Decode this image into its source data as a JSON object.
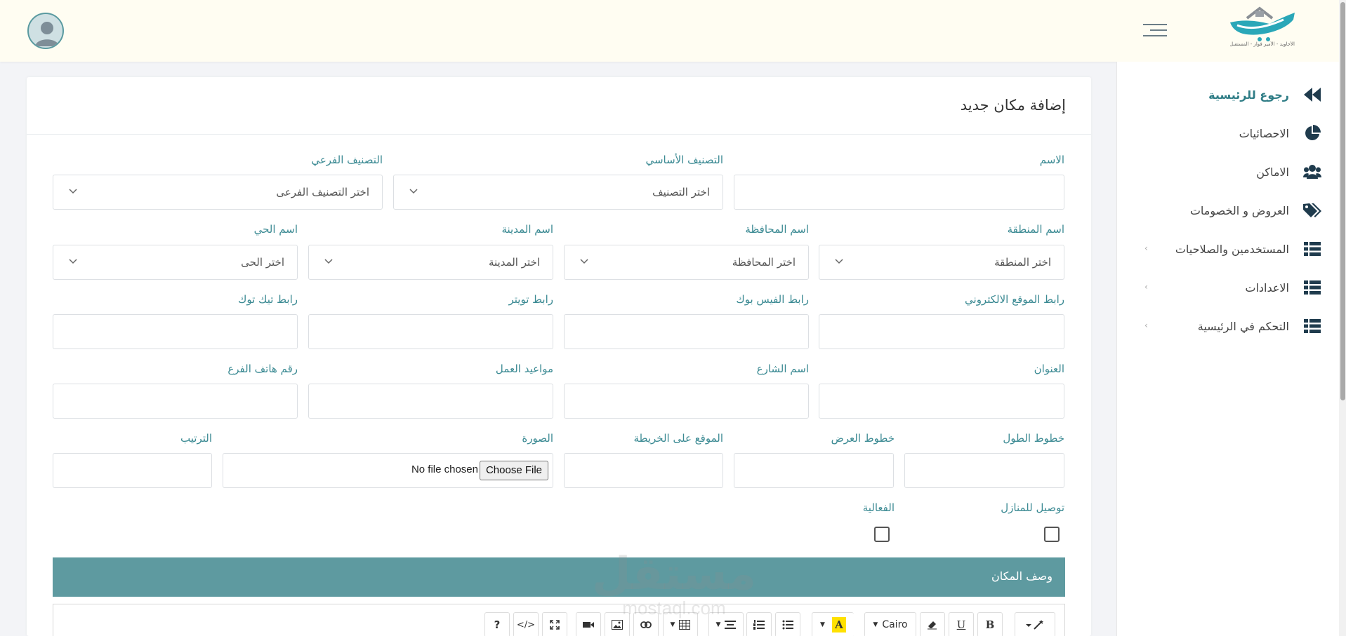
{
  "header": {
    "logo_tagline": "الأجاويد - الأمير فواز - المستقبل"
  },
  "sidebar": {
    "items": [
      {
        "label": "رجوع للرئيسية",
        "icon": "double-chevron-left-icon"
      },
      {
        "label": "الاحصائيات",
        "icon": "pie-chart-icon"
      },
      {
        "label": "الاماكن",
        "icon": "users-icon"
      },
      {
        "label": "العروض و الخصومات",
        "icon": "tags-icon"
      },
      {
        "label": "المستخدمين والصلاحيات",
        "icon": "list-icon"
      },
      {
        "label": "الاعدادات",
        "icon": "list-icon"
      },
      {
        "label": "التحكم في الرئيسية",
        "icon": "list-icon"
      }
    ]
  },
  "form": {
    "title": "إضافة مكان جديد",
    "labels": {
      "name": "الاسم",
      "main_category": "التصنيف الأساسي",
      "sub_category": "التصنيف الفرعي",
      "region": "اسم المنطقة",
      "governorate": "اسم المحافظة",
      "city": "اسم المدينة",
      "district": "اسم الحي",
      "website": "رابط الموقع الالكتروني",
      "facebook": "رابط الفيس بوك",
      "twitter": "رابط تويتر",
      "tiktok": "رابط تيك توك",
      "address": "العنوان",
      "street": "اسم الشارع",
      "hours": "مواعيد العمل",
      "branch_phone": "رقم هاتف الفرع",
      "longitude": "خطوط الطول",
      "latitude": "خطوط العرض",
      "map_location": "الموقع على الخريطة",
      "image": "الصورة",
      "order": "الترتيب",
      "home_delivery": "توصيل للمنازل",
      "active": "الفعالية"
    },
    "selects": {
      "main_category": "اختر التصنيف",
      "sub_category": "اختر التصنيف الفرعى",
      "region": "اختر المنطقة",
      "governorate": "اختر المحافظة",
      "city": "اختر المدينة",
      "district": "اختر الحى"
    },
    "file": {
      "button": "Choose File",
      "status": "No file chosen"
    },
    "description_title": "وصف المكان"
  },
  "editor_toolbar": {
    "font_name": "Cairo",
    "bold": "B",
    "underline": "U",
    "help": "?",
    "code": "</>"
  },
  "watermark": {
    "brand": "مستقل",
    "domain": "mostaql.com"
  },
  "colors": {
    "accent": "#3b8a93",
    "header_bg": "#fffdf2",
    "section_bar": "#5e9aa0"
  }
}
